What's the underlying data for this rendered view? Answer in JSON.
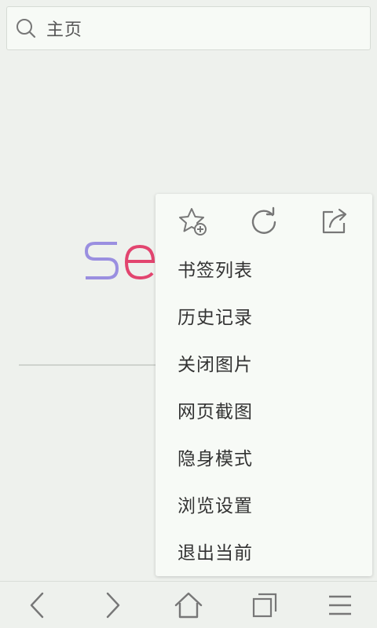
{
  "search": {
    "text": "主页",
    "icon": "search-icon"
  },
  "logo": {
    "letters": "Se",
    "colors": {
      "s": "#9a8fe0",
      "e": "#e2456f"
    }
  },
  "menu": {
    "quick_actions": [
      {
        "name": "add-bookmark",
        "icon": "star-plus-icon"
      },
      {
        "name": "refresh",
        "icon": "refresh-icon"
      },
      {
        "name": "share",
        "icon": "share-icon"
      }
    ],
    "items": [
      {
        "label": "书签列表"
      },
      {
        "label": "历史记录"
      },
      {
        "label": "关闭图片"
      },
      {
        "label": "网页截图"
      },
      {
        "label": "隐身模式"
      },
      {
        "label": "浏览设置"
      },
      {
        "label": "退出当前"
      }
    ]
  },
  "bottom_nav": {
    "buttons": [
      {
        "name": "back",
        "icon": "chevron-left-icon"
      },
      {
        "name": "forward",
        "icon": "chevron-right-icon"
      },
      {
        "name": "home",
        "icon": "home-icon"
      },
      {
        "name": "tabs",
        "icon": "tabs-icon"
      },
      {
        "name": "menu",
        "icon": "hamburger-icon"
      }
    ]
  },
  "colors": {
    "background": "#eef1ed",
    "menu_background": "#f7faf6",
    "icon_stroke": "#777777"
  }
}
